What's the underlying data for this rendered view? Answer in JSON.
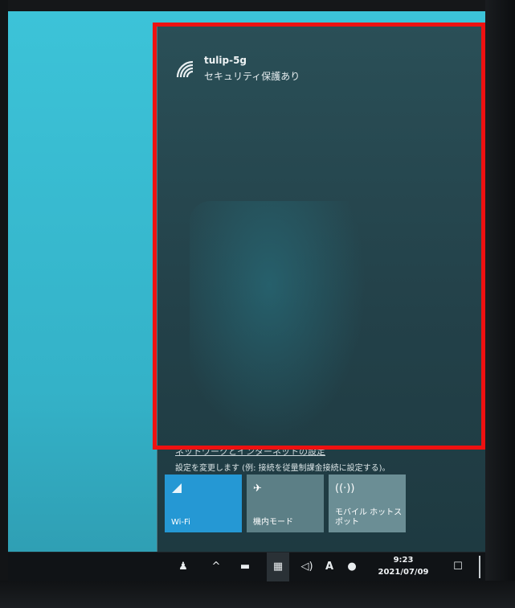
{
  "network": {
    "ssid": "tulip-5g",
    "status": "セキュリティ保護あり",
    "settings_link": "ネットワークとインターネットの設定",
    "settings_desc": "設定を変更します (例: 接続を従量制課金接続に設定する)。"
  },
  "quick_actions": [
    {
      "label": "Wi-Fi",
      "icon": "wifi-icon",
      "state": "on"
    },
    {
      "label": "機内モード",
      "icon": "airplane-icon",
      "state": "off"
    },
    {
      "label": "モバイル ホットスポット",
      "icon": "hotspot-icon",
      "state": "off"
    }
  ],
  "taskbar": {
    "time": "9:23",
    "date": "2021/07/09",
    "ime_indicator": "A"
  },
  "colors": {
    "desktop": "#36b9d0",
    "flyout": "#234149",
    "wifi_tile_on": "#2598d4",
    "highlight": "#ee1111",
    "taskbar": "#101316"
  }
}
